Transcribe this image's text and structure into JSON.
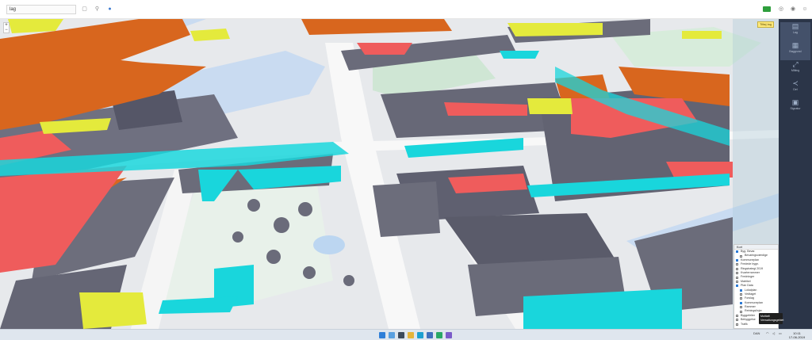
{
  "app": {
    "search_value": "lag",
    "toolbar_left_icons": [
      "window-icon",
      "pin-icon",
      "globe-icon"
    ],
    "toolbar_right_icons": [
      "green-badge-icon",
      "settings-icon",
      "info-icon",
      "user-icon"
    ]
  },
  "map": {
    "zoom_in": "+",
    "zoom_out": "−",
    "colors": {
      "water": "#c9dbf1",
      "park": "#d7ecdb",
      "road": "#f7f7f7",
      "building": "#6a6b7a",
      "orange": "#d8661e",
      "red": "#ef5c5c",
      "yellow": "#e4ea3c",
      "cyan": "#19d6dc"
    }
  },
  "right_tag": "Tilføj lag",
  "rail": {
    "items": [
      {
        "icon": "layers-icon",
        "label": "Lag"
      },
      {
        "icon": "grid-icon",
        "label": "Baggrund"
      },
      {
        "icon": "measure-icon",
        "label": "Måling"
      },
      {
        "icon": "share-icon",
        "label": "Del"
      },
      {
        "icon": "legend-icon",
        "label": "Signatur"
      }
    ]
  },
  "layers": {
    "header": "Kort",
    "rows": [
      {
        "label": "Byg. Bevar.",
        "checked": true,
        "sub": false
      },
      {
        "label": "Bevaringsværdige",
        "checked": false,
        "sub": true
      },
      {
        "label": "Kommuneplan",
        "checked": true,
        "sub": false
      },
      {
        "label": "Fredede bygn.",
        "checked": false,
        "sub": false
      },
      {
        "label": "Ringstrategi 2019",
        "checked": false,
        "sub": false
      },
      {
        "label": "Kvarterrammer",
        "checked": false,
        "sub": false
      },
      {
        "label": "Fredninger",
        "checked": false,
        "sub": false
      },
      {
        "label": "Matrikel",
        "checked": false,
        "sub": false
      },
      {
        "label": "Plan Data",
        "checked": true,
        "sub": false
      },
      {
        "label": "Lokalplan",
        "checked": true,
        "sub": true
      },
      {
        "label": "Vedtaget",
        "checked": false,
        "sub": true
      },
      {
        "label": "Forslag",
        "checked": false,
        "sub": true
      },
      {
        "label": "Kommuneplan",
        "checked": true,
        "sub": true
      },
      {
        "label": "Rammer",
        "checked": false,
        "sub": true
      },
      {
        "label": "Retningslinjer",
        "checked": false,
        "sub": true
      },
      {
        "label": "Byggefelter",
        "checked": false,
        "sub": false
      },
      {
        "label": "Bebyggelse",
        "checked": false,
        "sub": false
      },
      {
        "label": "Trafik",
        "checked": false,
        "sub": false
      }
    ]
  },
  "tooltip": "Multiaft Verwaltungsgebiet",
  "taskbar": {
    "apps": [
      "start-icon",
      "search-icon",
      "taskview-icon",
      "explorer-icon",
      "edge-icon",
      "store-icon",
      "app-icon",
      "app2-icon"
    ],
    "lang": "DAN",
    "time": "10:11",
    "date": "17-06-2019"
  }
}
